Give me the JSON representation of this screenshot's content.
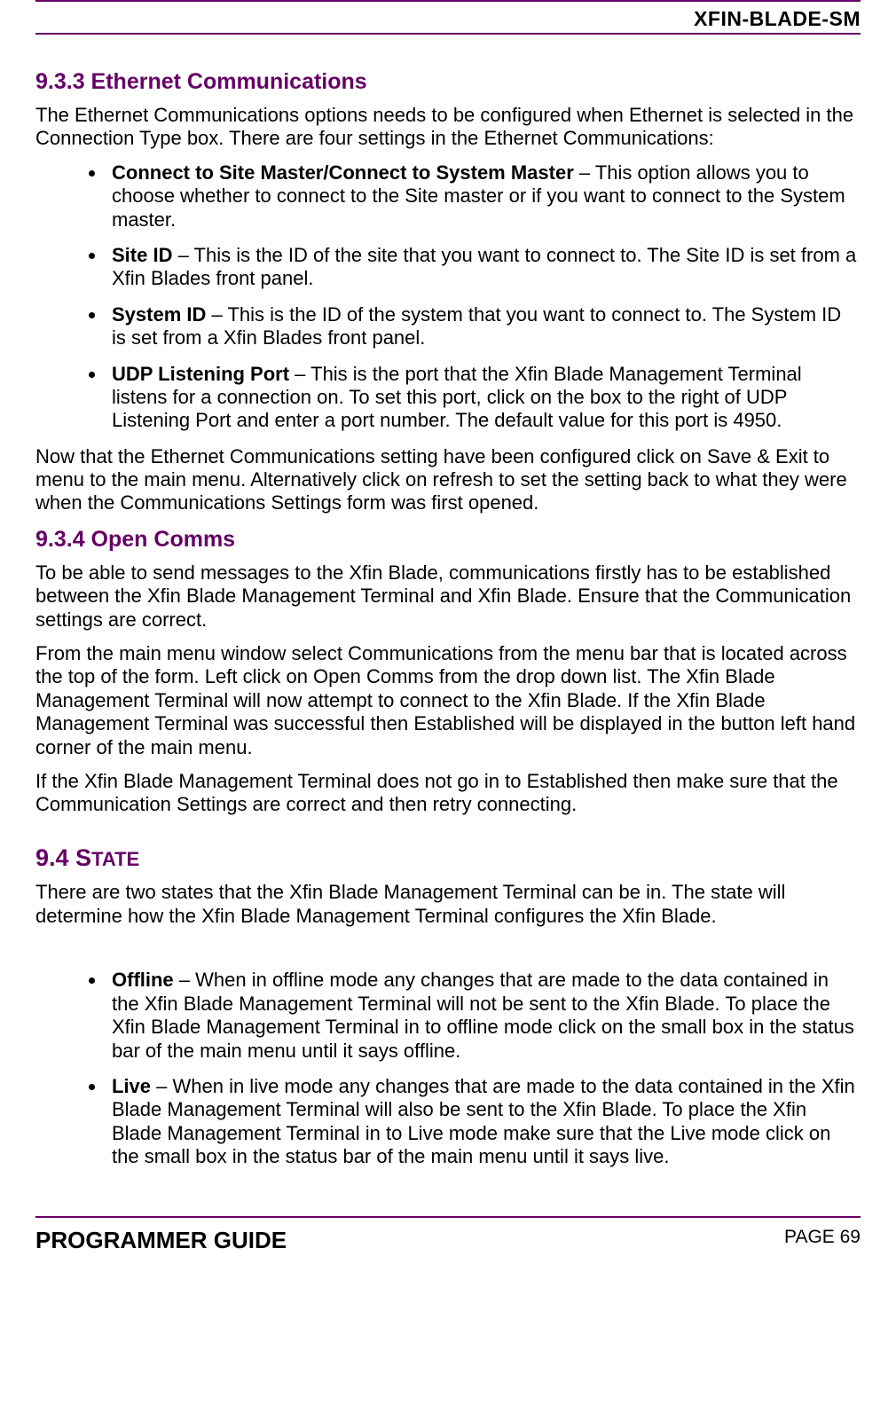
{
  "header": {
    "doc_id": "XFIN-BLADE-SM"
  },
  "s933": {
    "title": "9.3.3 Ethernet Communications",
    "intro": "The Ethernet Communications options needs to be configured when Ethernet is selected in the Connection Type box. There are four settings in the Ethernet Communications:",
    "items": [
      {
        "label": "Connect to Site Master/Connect to System Master",
        "text": " – This option allows you to choose whether to connect to the Site master or if you want to connect to the System master."
      },
      {
        "label": "Site ID",
        "text": " – This is the ID of the site that you want to connect to. The Site ID is set from a Xfin Blades front panel."
      },
      {
        "label": "System ID",
        "text": " – This is the ID of the system that you want to connect to. The System ID is set from a Xfin Blades front panel."
      },
      {
        "label": "UDP Listening Port",
        "text": " – This is the port that the Xfin Blade Management Terminal listens for a connection on. To set this port, click on the box to the right of UDP Listening Port and enter a port number. The default value for this port is 4950."
      }
    ],
    "outro": "Now that the Ethernet Communications setting have been configured click on Save & Exit to menu to the main menu. Alternatively click on refresh to set the setting back to what they were when the Communications Settings form was first opened."
  },
  "s934": {
    "title": "9.3.4 Open Comms",
    "p1": "To be able to send messages to the Xfin Blade, communications firstly has to be established between the Xfin Blade Management Terminal and Xfin Blade. Ensure that the Communication settings are correct.",
    "p2": "From the main menu window select Communications from the menu bar that is located across the top of the form. Left click on Open Comms from the drop down list. The Xfin Blade Management Terminal will now attempt to connect to the Xfin Blade. If the Xfin Blade Management Terminal was successful then Established will be displayed in the button left hand corner of the main menu.",
    "p3": "If the Xfin Blade Management Terminal does not go in to Established then make sure that the Communication Settings are correct and then retry connecting."
  },
  "s94": {
    "title_num": "9.4 ",
    "title_first": "S",
    "title_rest": "TATE",
    "p1": "There are two states that the Xfin Blade Management Terminal can be in.  The state will determine how the Xfin Blade Management Terminal configures the Xfin Blade.",
    "items": [
      {
        "label": "Offline",
        "text": " – When in offline mode any changes that are made to the data contained in the Xfin Blade Management Terminal will not be sent to the Xfin Blade. To place the Xfin Blade Management Terminal in to offline mode click on the small box in the status bar of the main menu until it says offline."
      },
      {
        "label": "Live",
        "text": " – When in live mode any changes that are made to the data contained in the Xfin Blade Management Terminal will also be sent to the Xfin Blade. To place the Xfin Blade Management Terminal in to Live mode make sure that the Live mode click on the small box in the status bar of the main menu until it says live."
      }
    ]
  },
  "footer": {
    "left": "PROGRAMMER GUIDE",
    "right": "PAGE 69"
  }
}
